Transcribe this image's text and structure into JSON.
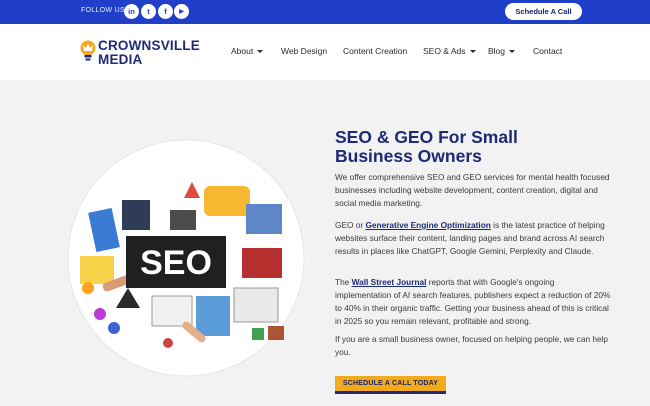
{
  "topbar": {
    "follow_label": "FOLLOW US:",
    "social": [
      {
        "name": "linkedin",
        "glyph": "in"
      },
      {
        "name": "twitter",
        "glyph": "t"
      },
      {
        "name": "facebook",
        "glyph": "f"
      },
      {
        "name": "youtube",
        "glyph": "▶"
      }
    ],
    "schedule_button": "Schedule A Call"
  },
  "header": {
    "logo_line1": "CROWNSVILLE",
    "logo_line2": "MEDIA",
    "nav": [
      {
        "label": "About",
        "dropdown": true
      },
      {
        "label": "Web Design",
        "dropdown": false
      },
      {
        "label": "Content Creation",
        "dropdown": false
      },
      {
        "label": "SEO & Ads",
        "dropdown": true
      },
      {
        "label": "Blog",
        "dropdown": true
      },
      {
        "label": "Contact",
        "dropdown": false
      }
    ]
  },
  "hero": {
    "image_text": "SEO",
    "title_line1": "SEO & GEO For Small",
    "title_line2": "Business Owners",
    "p1": "We offer comprehensive SEO and GEO services for mental health focused businesses including website development, content creation, digital and social media marketing.",
    "p2_pre": "GEO or ",
    "p2_link": "Generative Engine Optimization",
    "p2_post": " is the latest practice of helping websites surface their content, landing pages and brand across AI search results in places like ChatGPT, Google Gemini, Perplexity and Claude.",
    "p3_pre": "The ",
    "p3_link": "Wall Street Journal",
    "p3_post": " reports that with Google's ongoing implementation of AI search features, publishers expect a reduction of 20% to 40% in their organic traffic. Getting your business ahead of this is critical in 2025 so you remain relevant, profitable and strong.",
    "p4": "If you are a small business owner, focused on helping people, we can help you.",
    "cta": "SCHEDULE A CALL TODAY"
  },
  "colors": {
    "brand_blue": "#1f3fc8",
    "navy": "#1e2a78",
    "accent_orange": "#f2a91d",
    "background": "#f2f2f2"
  }
}
